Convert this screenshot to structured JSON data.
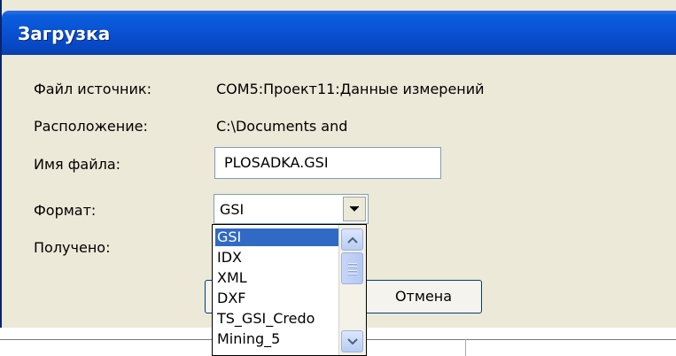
{
  "dialog": {
    "title": "Загрузка",
    "source_file_label": "Файл источник:",
    "source_file_value": "COM5:Проект11:Данные измерений",
    "location_label": "Расположение:",
    "location_value": "C:\\Documents and",
    "filename_label": "Имя файла:",
    "filename_value": "PLOSADKA.GSI",
    "format_label": "Формат:",
    "format_value": "GSI",
    "received_label": "Получено:",
    "cancel_label": "Отмена"
  },
  "format_options": [
    "GSI",
    "IDX",
    "XML",
    "DXF",
    "TS_GSI_Credo",
    "Mining_5"
  ],
  "selected_option_index": 0,
  "colors": {
    "title_bar": "#0a52d4",
    "dialog_bg": "#ece9d8",
    "selection": "#316ac5"
  }
}
